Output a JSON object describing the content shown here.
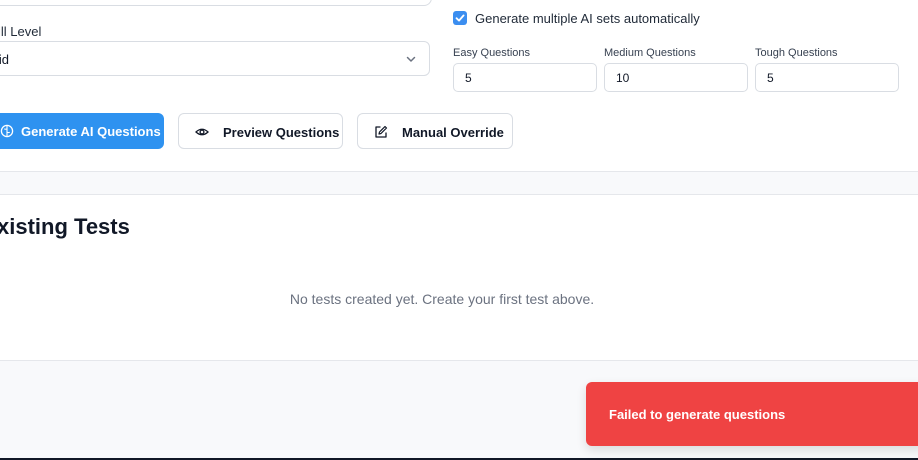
{
  "form": {
    "skill_level_label": "ill Level",
    "skill_level_value": "Mid",
    "auto_sets_label": "Generate multiple AI sets automatically",
    "auto_sets_checked": true,
    "easy_label": "Easy Questions",
    "easy_value": "5",
    "medium_label": "Medium Questions",
    "medium_value": "10",
    "tough_label": "Tough Questions",
    "tough_value": "5"
  },
  "actions": {
    "generate_label": "Generate AI Questions",
    "preview_label": "Preview Questions",
    "override_label": "Manual Override"
  },
  "tests": {
    "heading": "xisting Tests",
    "empty_message": "No tests created yet. Create your first test above."
  },
  "toast": {
    "message": "Failed to generate questions",
    "color": "#ef4343"
  },
  "icons": {
    "generate": "brain-icon",
    "preview": "eye-icon",
    "override": "edit-icon",
    "select": "chevron-down-icon",
    "checkbox": "check-icon"
  },
  "colors": {
    "primary": "#2e92f0",
    "checkbox": "#3b8ef0",
    "error": "#ef4343"
  }
}
